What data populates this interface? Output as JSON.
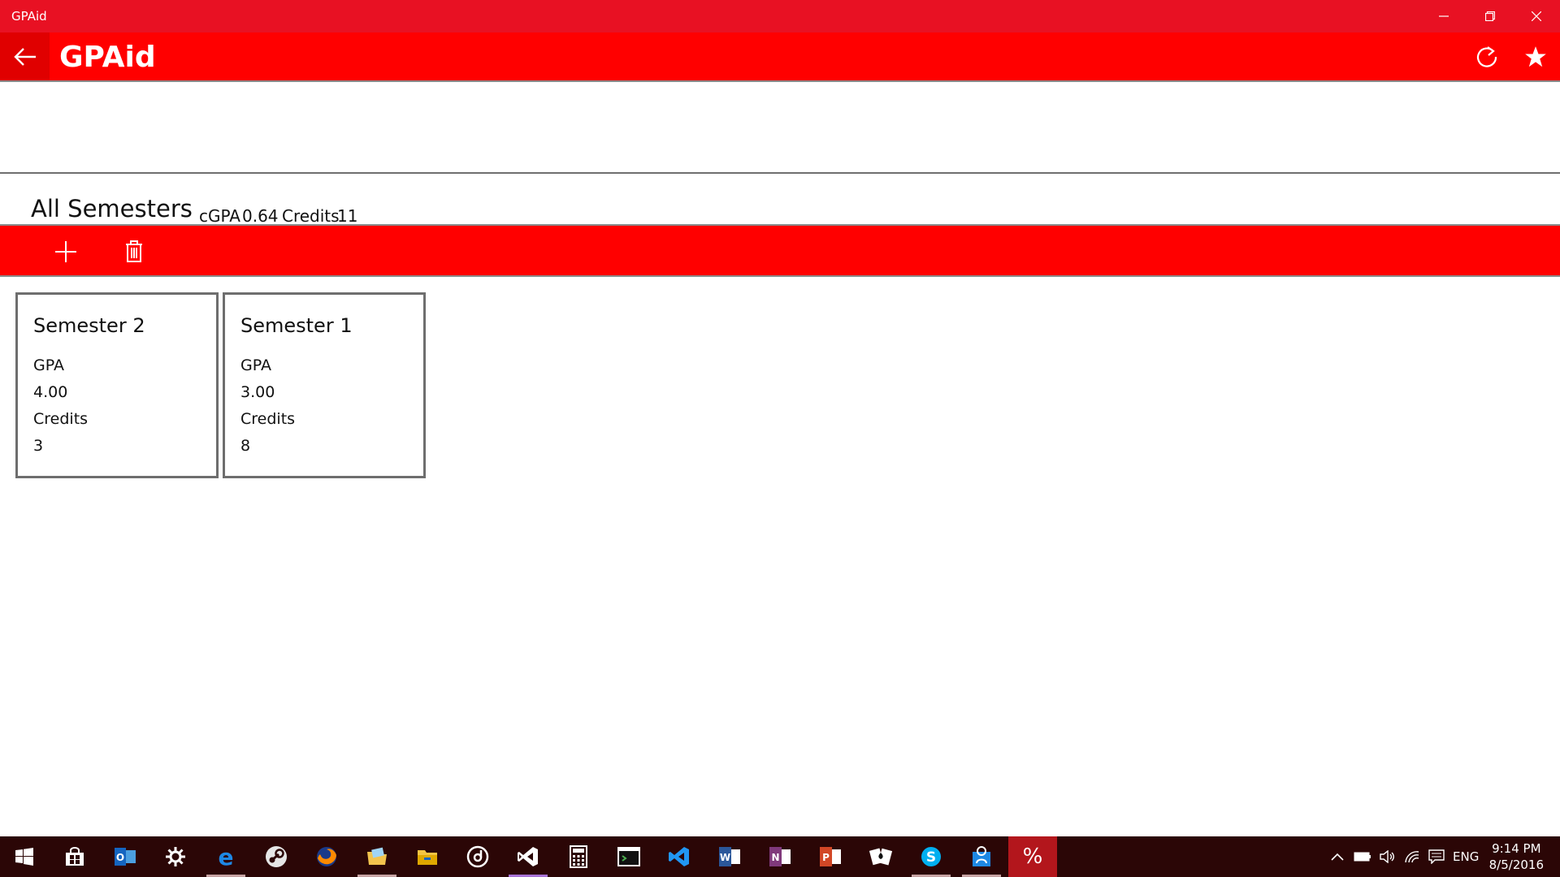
{
  "window": {
    "title": "GPAid"
  },
  "header": {
    "app_name": "GPAid"
  },
  "summary": {
    "heading": "All Semesters",
    "cgpa_label": "cGPA",
    "cgpa_value": "0.64",
    "credits_label": "Credits",
    "credits_value": "11"
  },
  "semesters": [
    {
      "name": "Semester 2",
      "gpa_label": "GPA",
      "gpa": "4.00",
      "credits_label": "Credits",
      "credits": "3"
    },
    {
      "name": "Semester 1",
      "gpa_label": "GPA",
      "gpa": "3.00",
      "credits_label": "Credits",
      "credits": "8"
    }
  ],
  "taskbar": {
    "language": "ENG",
    "time": "9:14 PM",
    "date": "8/5/2016",
    "active_app_glyph": "%"
  },
  "colors": {
    "titlebar": "#e81123",
    "accent": "#ff0000",
    "taskbar": "#2b0606"
  }
}
